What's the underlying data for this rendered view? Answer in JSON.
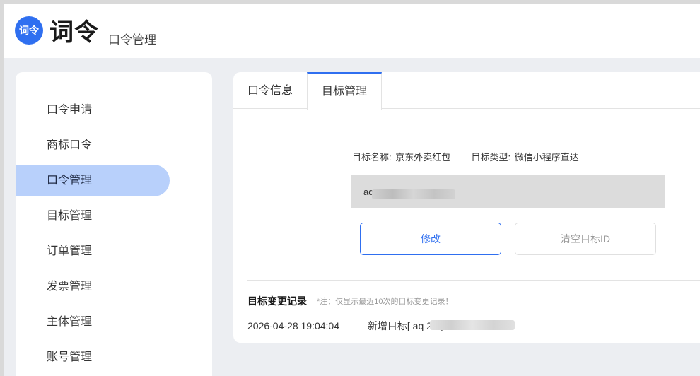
{
  "header": {
    "logo_text": "词令",
    "brand": "词令",
    "subtitle": "口令管理"
  },
  "sidebar": {
    "items": [
      {
        "label": "口令申请",
        "active": false
      },
      {
        "label": "商标口令",
        "active": false
      },
      {
        "label": "口令管理",
        "active": true
      },
      {
        "label": "目标管理",
        "active": false
      },
      {
        "label": "订单管理",
        "active": false
      },
      {
        "label": "发票管理",
        "active": false
      },
      {
        "label": "主体管理",
        "active": false
      },
      {
        "label": "账号管理",
        "active": false
      }
    ]
  },
  "tabs": [
    {
      "label": "口令信息",
      "active": false
    },
    {
      "label": "目标管理",
      "active": true
    }
  ],
  "target": {
    "name_label": "目标名称:",
    "name_value": "京东外卖红包",
    "type_label": "目标类型:",
    "type_value": "微信小程序直达",
    "id_value": "aq                    720"
  },
  "buttons": {
    "modify": "修改",
    "clear": "清空目标ID"
  },
  "records": {
    "title": "目标变更记录",
    "note": "*注：仅显示最近10次的目标变更记录！",
    "rows": [
      {
        "time": "2026-04-28 19:04:04",
        "action": "新增目标[ aq                    20 ]"
      }
    ]
  },
  "colors": {
    "accent": "#2f6ff0",
    "active_nav": "#b8d0fb",
    "background": "#eceef2"
  }
}
